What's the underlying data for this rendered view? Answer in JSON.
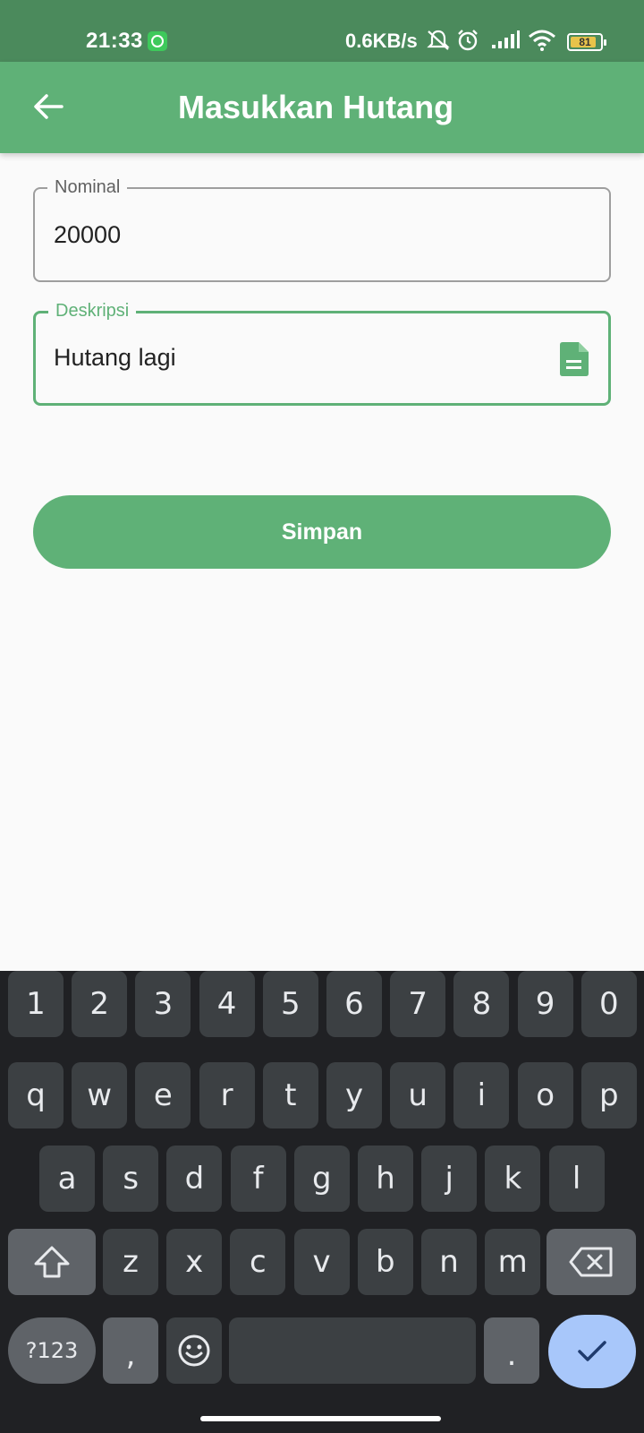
{
  "status_bar": {
    "time": "21:33",
    "network_speed": "0.6KB/s",
    "battery_level": "81",
    "icons": [
      "whatsapp-icon",
      "bell-off-icon",
      "alarm-icon",
      "signal-icon",
      "wifi-icon",
      "battery-icon"
    ]
  },
  "app_bar": {
    "title": "Masukkan Hutang",
    "back_icon": "arrow-left-icon",
    "background": "#5fb177"
  },
  "form": {
    "nominal": {
      "label": "Nominal",
      "value": "20000"
    },
    "deskripsi": {
      "label": "Deskripsi",
      "value": "Hutang lagi",
      "icon": "document-icon"
    },
    "save_label": "Simpan"
  },
  "keyboard": {
    "row_numbers": [
      "1",
      "2",
      "3",
      "4",
      "5",
      "6",
      "7",
      "8",
      "9",
      "0"
    ],
    "row_top": [
      "q",
      "w",
      "e",
      "r",
      "t",
      "y",
      "u",
      "i",
      "o",
      "p"
    ],
    "row_middle": [
      "a",
      "s",
      "d",
      "f",
      "g",
      "h",
      "j",
      "k",
      "l"
    ],
    "row_bottom": [
      "z",
      "x",
      "c",
      "v",
      "b",
      "n",
      "m"
    ],
    "symbols_label": "?123",
    "comma_label": ",",
    "period_label": ".",
    "icons": [
      "shift-icon",
      "backspace-icon",
      "emoji-icon",
      "check-icon"
    ]
  },
  "colors": {
    "accent": "#5fb177",
    "status_bar": "#4b8a5c",
    "keyboard_bg": "#202124",
    "key_bg": "#3c4043",
    "enter_key": "#a8c7fa"
  }
}
